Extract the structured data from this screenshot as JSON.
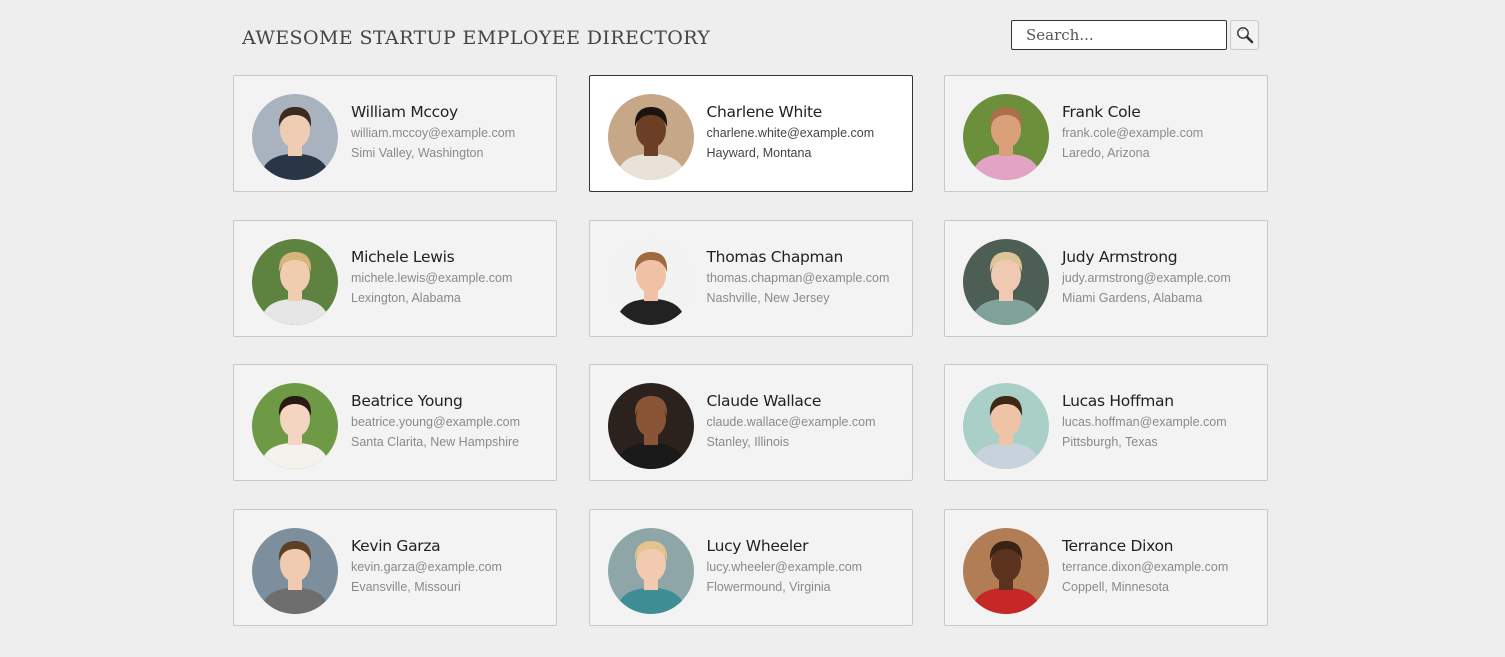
{
  "header": {
    "title": "AWESOME STARTUP EMPLOYEE DIRECTORY"
  },
  "search": {
    "placeholder": "Search...",
    "value": "",
    "button_icon": "search-icon"
  },
  "employees": [
    {
      "name": "William Mccoy",
      "email": "william.mccoy@example.com",
      "location": "Simi Valley, Washington",
      "selected": false,
      "avatar": {
        "bg": "#a9b3bf",
        "skin": "#efcdb5",
        "hair": "#3b2a1f",
        "shirt": "#283646"
      }
    },
    {
      "name": "Charlene White",
      "email": "charlene.white@example.com",
      "location": "Hayward, Montana",
      "selected": true,
      "avatar": {
        "bg": "#c6a889",
        "skin": "#6b3f26",
        "hair": "#1c1410",
        "shirt": "#e8e2d8"
      }
    },
    {
      "name": "Frank Cole",
      "email": "frank.cole@example.com",
      "location": "Laredo, Arizona",
      "selected": false,
      "avatar": {
        "bg": "#6c8f3c",
        "skin": "#d9a07a",
        "hair": "#a8714a",
        "shirt": "#e3a3c4"
      }
    },
    {
      "name": "Michele Lewis",
      "email": "michele.lewis@example.com",
      "location": "Lexington, Alabama",
      "selected": false,
      "avatar": {
        "bg": "#5e8240",
        "skin": "#f1cdb0",
        "hair": "#d6b47a",
        "shirt": "#e6e6e6"
      }
    },
    {
      "name": "Thomas Chapman",
      "email": "thomas.chapman@example.com",
      "location": "Nashville, New Jersey",
      "selected": false,
      "avatar": {
        "bg": "#f2f2f2",
        "skin": "#efc2a6",
        "hair": "#a06a3f",
        "shirt": "#222222"
      }
    },
    {
      "name": "Judy Armstrong",
      "email": "judy.armstrong@example.com",
      "location": "Miami Gardens, Alabama",
      "selected": false,
      "avatar": {
        "bg": "#4d5e55",
        "skin": "#efc9b1",
        "hair": "#ddc499",
        "shirt": "#7fa39a"
      }
    },
    {
      "name": "Beatrice Young",
      "email": "beatrice.young@example.com",
      "location": "Santa Clarita, New Hampshire",
      "selected": false,
      "avatar": {
        "bg": "#6e9a45",
        "skin": "#f3d5c2",
        "hair": "#2a1a12",
        "shirt": "#f5f2ee"
      }
    },
    {
      "name": "Claude Wallace",
      "email": "claude.wallace@example.com",
      "location": "Stanley, Illinois",
      "selected": false,
      "avatar": {
        "bg": "#2b211d",
        "skin": "#8a5536",
        "hair": "#8a5536",
        "shirt": "#1a1a1a"
      }
    },
    {
      "name": "Lucas Hoffman",
      "email": "lucas.hoffman@example.com",
      "location": "Pittsburgh, Texas",
      "selected": false,
      "avatar": {
        "bg": "#a9cfc6",
        "skin": "#efc3a5",
        "hair": "#3d2818",
        "shirt": "#c7d2dc"
      }
    },
    {
      "name": "Kevin Garza",
      "email": "kevin.garza@example.com",
      "location": "Evansville, Missouri",
      "selected": false,
      "avatar": {
        "bg": "#7d8f9c",
        "skin": "#f0cbb0",
        "hair": "#5e3f26",
        "shirt": "#6e6e6e"
      }
    },
    {
      "name": "Lucy Wheeler",
      "email": "lucy.wheeler@example.com",
      "location": "Flowermound, Virginia",
      "selected": false,
      "avatar": {
        "bg": "#8fa6a8",
        "skin": "#f1cab0",
        "hair": "#e4c48c",
        "shirt": "#3f8e96"
      }
    },
    {
      "name": "Terrance Dixon",
      "email": "terrance.dixon@example.com",
      "location": "Coppell, Minnesota",
      "selected": false,
      "avatar": {
        "bg": "#b07d55",
        "skin": "#5a321e",
        "hair": "#3a2215",
        "shirt": "#c62828"
      }
    }
  ]
}
